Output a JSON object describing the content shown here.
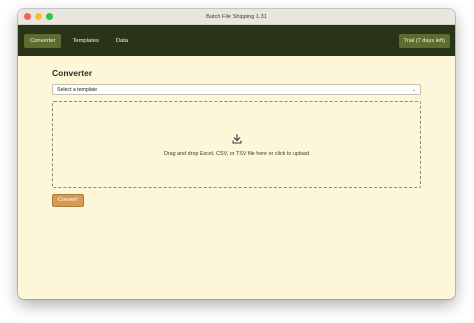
{
  "window": {
    "title": "Batch File Shipping 1.31",
    "traffic_lights": [
      "#fe5f57",
      "#febc2e",
      "#28c840"
    ]
  },
  "nav": {
    "items": [
      {
        "label": "Converter",
        "active": true
      },
      {
        "label": "Templates",
        "active": false
      },
      {
        "label": "Data",
        "active": false
      }
    ],
    "trial_label": "Trial (7 days left)"
  },
  "converter": {
    "heading": "Converter",
    "template_select": {
      "value": "Select a template"
    },
    "dropzone": {
      "icon": "download-icon",
      "text": "Drag and drop Excel, CSV, or TSV file here or click to upload"
    },
    "convert_label": "Convert"
  },
  "colors": {
    "nav_background": "#283318",
    "nav_active": "#5c6e2f",
    "content_background": "#fdf6d8",
    "convert_button": "#d69a55"
  }
}
